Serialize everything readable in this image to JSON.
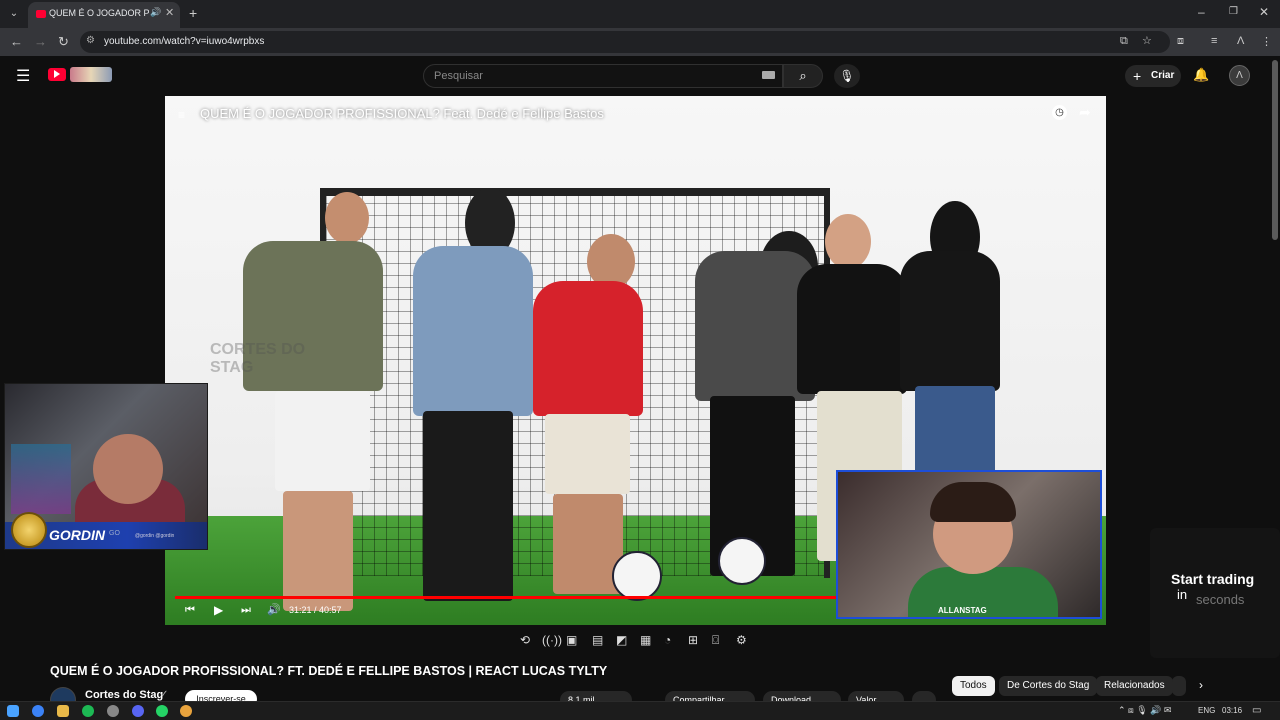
{
  "browser": {
    "tab_title": "QUEM É O JOGADOR PROFISSIONAL? Feat. Dedé e Fellipe Bastos",
    "url": "youtube.com/watch?v=iuwo4wrpbxs"
  },
  "youtube": {
    "search_placeholder": "Pesquisar",
    "create_label": "Criar"
  },
  "player": {
    "title": "QUEM É O JOGADOR PROFISSIONAL? Feat. Dedé e Fellipe Bastos",
    "watermark": "CORTES DO STAG",
    "time": "31:21 / 40:57",
    "progress_fraction": 0.765,
    "cam_left_name": "GORDIN",
    "cam_left_tag": "GO",
    "cam_left_handles": "@gordin  @gordin",
    "cam_right_handle": "ALLANSTAG"
  },
  "video": {
    "page_title": "QUEM É O JOGADOR PROFISSIONAL? FT. DEDÉ E FELLIPE BASTOS | REACT LUCAS TYLTY",
    "channel": "Cortes do Stag",
    "subscribe_label": "Inscrever-se",
    "likes": "8,1 mil",
    "share_label": "Compartilhar",
    "download_label": "Download",
    "save_label": "Valor"
  },
  "ad": {
    "line1": "Start trading",
    "line2a": "in",
    "line2b": "seconds"
  },
  "chips": {
    "all": "Todos",
    "channel": "De Cortes do Stag",
    "related": "Relacionados"
  },
  "taskbar": {
    "language": "ENG",
    "time": "03:16"
  },
  "colors": {
    "youtube_red": "#ff0033",
    "background": "#0f0f0f",
    "progress": "#ff0000"
  }
}
